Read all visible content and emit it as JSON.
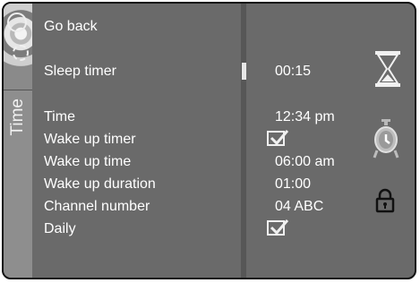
{
  "side_tab": {
    "label": "Time"
  },
  "menu": {
    "go_back": "Go back",
    "sleep_timer": {
      "label": "Sleep timer",
      "value": "00:15"
    },
    "time": {
      "label": "Time",
      "value": "12:34 pm"
    },
    "wake_up_timer": {
      "label": "Wake up timer",
      "checked": true
    },
    "wake_up_time": {
      "label": "Wake up time",
      "value": "06:00 am"
    },
    "wake_up_duration": {
      "label": "Wake up duration",
      "value": "01:00"
    },
    "channel_number": {
      "label": "Channel number",
      "value": "04 ABC"
    },
    "daily": {
      "label": "Daily",
      "checked": true
    }
  },
  "icons": [
    "hourglass-icon",
    "alarm-clock-icon",
    "padlock-icon"
  ],
  "colors": {
    "panel": "#6a6a6a",
    "strip": "#8e8e8e",
    "text": "#ffffff",
    "divider": "#575757"
  }
}
